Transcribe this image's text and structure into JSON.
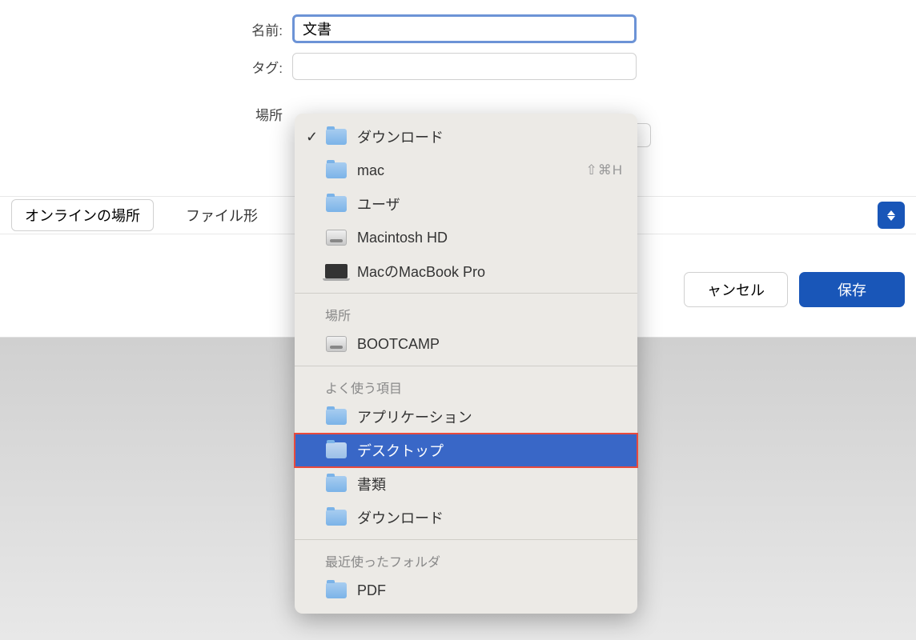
{
  "labels": {
    "name": "名前:",
    "tags": "タグ:",
    "location": "場所",
    "online_locations": "オンラインの場所",
    "file_format": "ファイル形",
    "cancel": "ャンセル",
    "save": "保存",
    "section_places": "場所",
    "section_favorites": "よく使う項目",
    "section_recent": "最近使ったフォルダ"
  },
  "fields": {
    "name_value": "文書"
  },
  "menu": {
    "top": [
      {
        "label": "ダウンロード",
        "icon": "folder",
        "checked": true
      },
      {
        "label": "mac",
        "icon": "folder",
        "shortcut": "⇧⌘H"
      },
      {
        "label": "ユーザ",
        "icon": "folder"
      },
      {
        "label": "Macintosh HD",
        "icon": "disk"
      },
      {
        "label": "MacのMacBook Pro",
        "icon": "laptop"
      }
    ],
    "places": [
      {
        "label": "BOOTCAMP",
        "icon": "disk"
      }
    ],
    "favorites": [
      {
        "label": "アプリケーション",
        "icon": "folder"
      },
      {
        "label": "デスクトップ",
        "icon": "folder",
        "selected": true,
        "highlighted": true
      },
      {
        "label": "書類",
        "icon": "folder"
      },
      {
        "label": "ダウンロード",
        "icon": "folder"
      }
    ],
    "recent": [
      {
        "label": "PDF",
        "icon": "folder"
      }
    ]
  }
}
